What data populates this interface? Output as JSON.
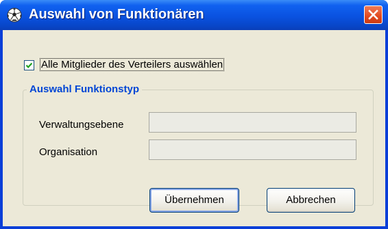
{
  "window": {
    "title": "Auswahl von Funktionären",
    "app_icon": "soccer-ball-icon",
    "close_icon": "close-icon"
  },
  "checkbox": {
    "label": "Alle Mitglieder des Verteilers auswählen",
    "checked": true
  },
  "group": {
    "title": "Auswahl Funktionstyp",
    "fields": [
      {
        "label": "Verwaltungsebene",
        "value": ""
      },
      {
        "label": "Organisation",
        "value": ""
      }
    ]
  },
  "buttons": {
    "ok_label": "Übernehmen",
    "cancel_label": "Abbrechen"
  },
  "colors": {
    "titlebar": "#0a52e0",
    "client": "#ece9d8",
    "group_title": "#0046d5",
    "close": "#e2491f"
  }
}
